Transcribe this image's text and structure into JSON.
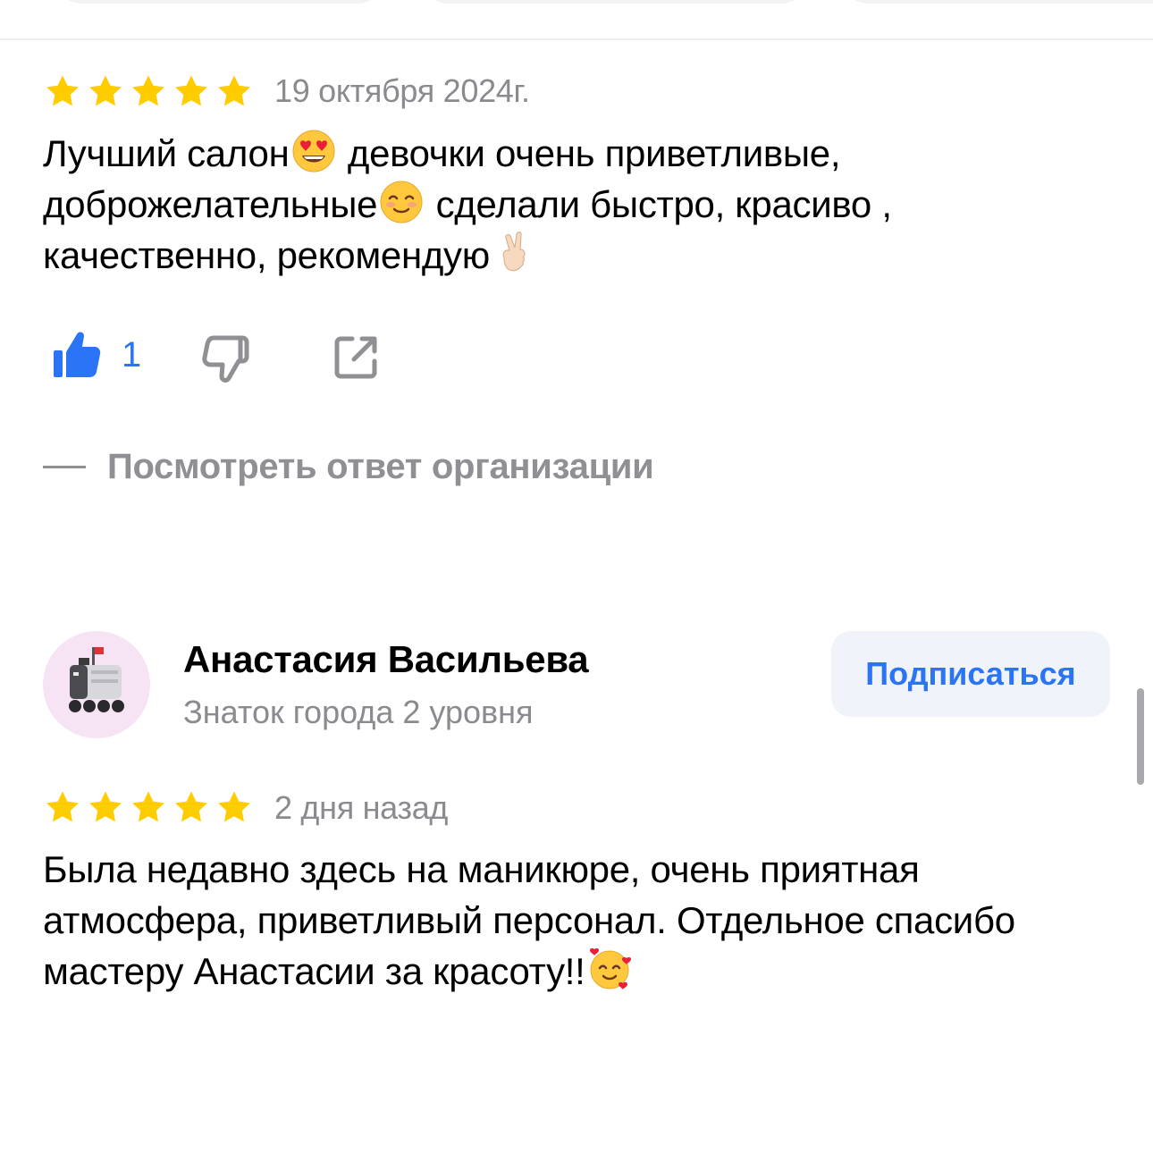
{
  "review1": {
    "rating": 5,
    "date": "19 октября 2024г.",
    "text_lines": [
      {
        "before": "Лучший салон",
        "emoji": "heart-eyes-emoji",
        "after": " девочки очень приветливые,"
      },
      {
        "before": "доброжелательные",
        "emoji": "smiling-emoji",
        "after": " сделали быстро, красиво ,"
      },
      {
        "before": "качественно, рекомендую",
        "emoji": "crossed-fingers-emoji",
        "after": ""
      }
    ],
    "likes": "1",
    "reply_link": "Посмотреть ответ организации"
  },
  "review2": {
    "author": "Анастасия Васильева",
    "level": "Знаток города 2 уровня",
    "subscribe_label": "Подписаться",
    "rating": 5,
    "date": "2 дня назад",
    "text_lines": [
      {
        "before": "Была недавно здесь на маникюре, очень приятная",
        "emoji": "",
        "after": ""
      },
      {
        "before": "атмосфера, приветливый персонал. Отдельное спасибо",
        "emoji": "",
        "after": ""
      },
      {
        "before": "мастеру Анастасии за красоту!!",
        "emoji": "smiling-face-with-hearts-emoji",
        "after": ""
      }
    ]
  },
  "colors": {
    "star": "#FFCC00",
    "accent_blue": "#2A74F5",
    "muted_text": "#8A8A8F",
    "avatar_bg": "#F6E4F5",
    "subscribe_bg": "#F0F4FA"
  }
}
